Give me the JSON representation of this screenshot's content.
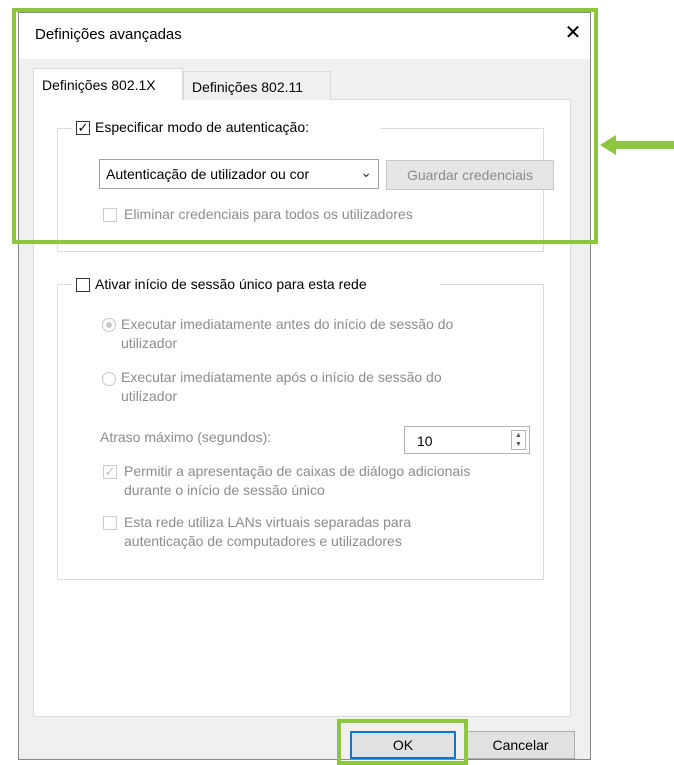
{
  "window": {
    "title": "Definições avançadas"
  },
  "tabs": [
    {
      "label": "Definições 802.1X",
      "active": true
    },
    {
      "label": "Definições 802.11",
      "active": false
    }
  ],
  "auth_group": {
    "checkbox_label": "Especificar modo de autenticação:",
    "checked": true,
    "mode_select_value": "Autenticação de utilizador ou cor",
    "save_credentials_label": "Guardar credenciais",
    "delete_credentials_label": "Eliminar credenciais para todos os utilizadores"
  },
  "sso_group": {
    "checkbox_label": "Ativar início de sessão único para esta rede",
    "checked": false,
    "radio_before_line1": "Executar imediatamente antes do início de sessão do",
    "radio_before_line2": "utilizador",
    "radio_after_line1": "Executar imediatamente após o início de sessão do",
    "radio_after_line2": "utilizador",
    "max_delay_label": "Atraso máximo (segundos):",
    "max_delay_value": "10",
    "allow_dialogs_line1": "Permitir a apresentação de caixas de diálogo adicionais",
    "allow_dialogs_line2": "durante o início de sessão único",
    "vlan_line1": "Esta rede utiliza LANs virtuais separadas para",
    "vlan_line2": "autenticação de computadores e utilizadores"
  },
  "buttons": {
    "ok": "OK",
    "cancel": "Cancelar"
  },
  "icons": {
    "close": "close-icon",
    "dropdown": "chevron-down-icon",
    "highlight_arrow": "arrow-left-icon"
  },
  "colors": {
    "highlight": "#8dc63f",
    "default_button_border": "#0078d7"
  }
}
